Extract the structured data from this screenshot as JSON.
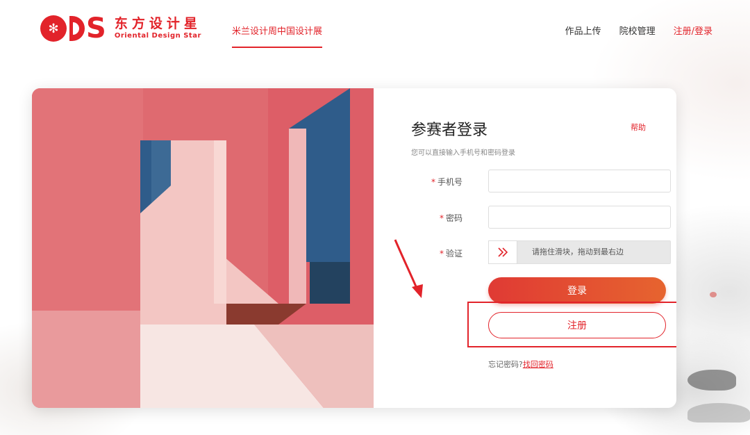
{
  "header": {
    "logo": {
      "mark_text": "S",
      "cn_name": "东方设计星",
      "en_name": "Oriental Design Star"
    },
    "exhibition_link": "米兰设计周中国设计展",
    "nav": [
      {
        "label": "作品上传"
      },
      {
        "label": "院校管理"
      },
      {
        "label": "注册/登录"
      }
    ]
  },
  "login_form": {
    "title": "参赛者登录",
    "help": "帮助",
    "hint": "您可以直接输入手机号和密码登录",
    "required_mark": "*",
    "phone": {
      "label": "手机号",
      "value": "",
      "placeholder": ""
    },
    "password": {
      "label": "密码",
      "value": "",
      "placeholder": ""
    },
    "verify": {
      "label": "验证",
      "slider_text": "请拖住滑块，拖动到最右边",
      "handle_icon": "double-chevron-right-icon"
    },
    "login_button": "登录",
    "register_button": "注册",
    "forgot_text": "忘记密码?",
    "recover_link": "找回密码"
  },
  "colors": {
    "brand_red": "#e2232a",
    "login_gradient_start": "#e03a34",
    "login_gradient_end": "#e6642f",
    "art_red": "#df6a70",
    "art_blue": "#2f5c8a",
    "art_pink": "#f3c6c3"
  }
}
